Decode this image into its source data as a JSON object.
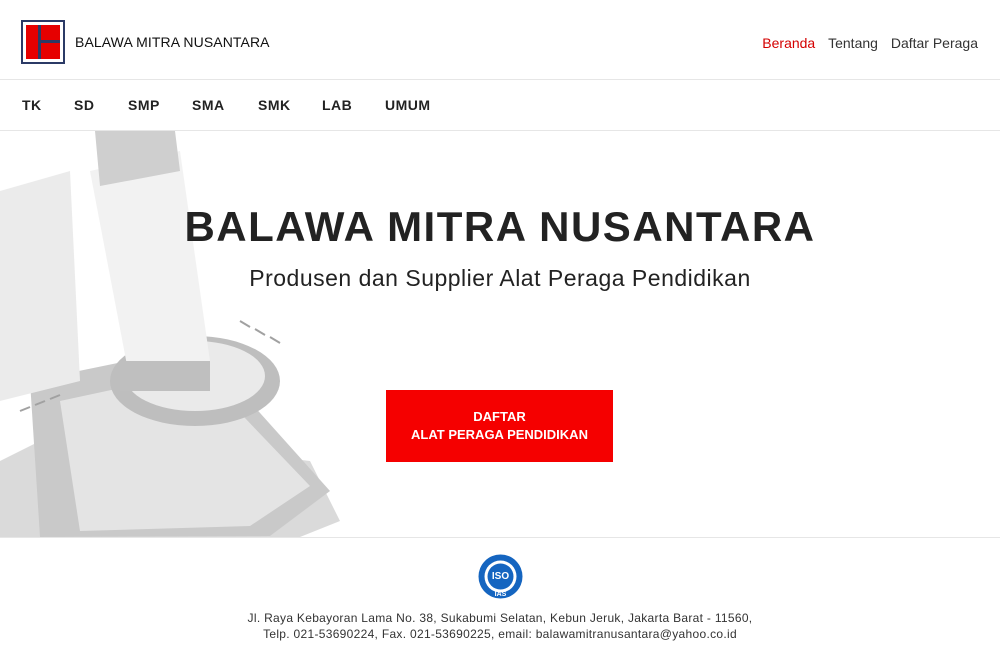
{
  "header": {
    "brand": "BALAWA MITRA NUSANTARA",
    "nav": [
      {
        "label": "Beranda",
        "active": true
      },
      {
        "label": "Tentang",
        "active": false
      },
      {
        "label": "Daftar Peraga",
        "active": false
      }
    ]
  },
  "categories": [
    "TK",
    "SD",
    "SMP",
    "SMA",
    "SMK",
    "LAB",
    "UMUM"
  ],
  "hero": {
    "title": "BALAWA MITRA NUSANTARA",
    "subtitle": "Produsen dan Supplier Alat Peraga Pendidikan",
    "cta_line1": "DAFTAR",
    "cta_line2": "ALAT PERAGA PENDIDIKAN"
  },
  "footer": {
    "iso_badge": "ISO",
    "iso_sub": "IAS",
    "address_line1": "Jl. Raya Kebayoran Lama No. 38, Sukabumi Selatan, Kebun Jeruk, Jakarta Barat - 11560,",
    "address_line2": "Telp. 021-53690224, Fax. 021-53690225, email: balawamitranusantara@yahoo.co.id"
  },
  "colors": {
    "accent": "#f50000",
    "logo_frame": "#2b3a66",
    "iso_blue": "#1565c0"
  }
}
